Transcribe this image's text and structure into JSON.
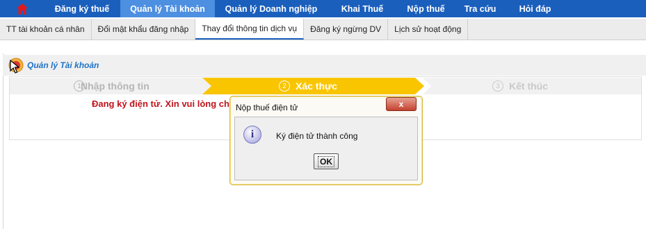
{
  "topnav": {
    "items": [
      {
        "label": "Đăng ký thuế"
      },
      {
        "label": "Quản lý Tài khoản",
        "active": true
      },
      {
        "label": "Quản lý Doanh nghiệp"
      },
      {
        "label": "Khai Thuế"
      },
      {
        "label": "Nộp thuế"
      },
      {
        "label": "Tra cứu"
      },
      {
        "label": "Hỏi đáp"
      }
    ]
  },
  "subnav": {
    "items": [
      {
        "label": "TT tài khoản cá nhân"
      },
      {
        "label": "Đổi mật khẩu đăng nhập"
      },
      {
        "label": "Thay đổi thông tin dịch vụ",
        "active": true
      },
      {
        "label": "Đăng ký ngừng DV"
      },
      {
        "label": "Lịch sử hoạt động"
      }
    ]
  },
  "section": {
    "title": "Quản lý Tài khoản"
  },
  "steps": [
    {
      "num": "1",
      "label": "Nhập thông tin"
    },
    {
      "num": "2",
      "label": "Xác thực",
      "active": true
    },
    {
      "num": "3",
      "label": "Kết thúc"
    }
  ],
  "warning": "Đang ký điện tử. Xin vui lòng ch",
  "dialog": {
    "title": "Nộp thuế điện tử",
    "close_label": "x",
    "icon_glyph": "i",
    "message": "Ký điện tử thành công",
    "ok_label": "OK"
  },
  "colors": {
    "nav_bg": "#1b5fbd",
    "nav_active": "#4d8fe0",
    "step_active": "#f9c500",
    "warning": "#c0141c"
  }
}
